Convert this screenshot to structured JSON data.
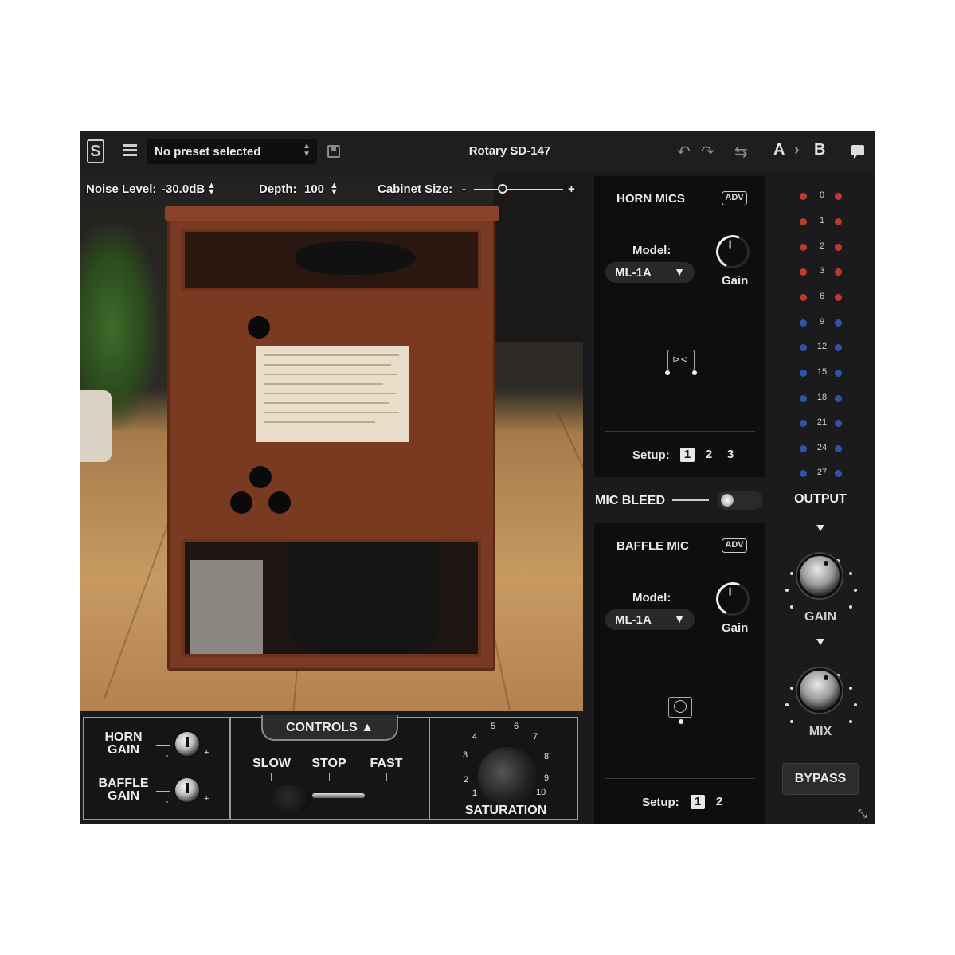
{
  "topbar": {
    "logo": "S",
    "preset": "No preset selected",
    "title": "Rotary SD-147",
    "ab_a": "A",
    "ab_sep": "›",
    "ab_b": "B",
    "icons": [
      "menu-icon",
      "save-icon",
      "undo-icon",
      "redo-icon",
      "compare-icon",
      "chat-icon"
    ]
  },
  "scene_params": {
    "noise_label": "Noise Level:",
    "noise_value": "-30.0dB",
    "depth_label": "Depth:",
    "depth_value": "100",
    "cabinet_label": "Cabinet Size:",
    "cabinet_minus": "-",
    "cabinet_plus": "+",
    "cabinet_size_position": 0.32
  },
  "controls": {
    "tab_label": "CONTROLS ▲",
    "horn_gain": "HORN\nGAIN",
    "baffle_gain": "BAFFLE\nGAIN",
    "minus": "-",
    "plus": "+",
    "slow": "SLOW",
    "stop": "STOP",
    "fast": "FAST",
    "saturation": "SATURATION",
    "saturation_scale": [
      "1",
      "2",
      "3",
      "4",
      "5",
      "6",
      "7",
      "8",
      "9",
      "10"
    ]
  },
  "horn_mics": {
    "title": "HORN MICS",
    "adv": "ADV",
    "model_label": "Model:",
    "model_value": "ML-1A",
    "gain_label": "Gain",
    "setup_label": "Setup:",
    "setups": [
      "1",
      "2",
      "3"
    ],
    "active_setup": "1"
  },
  "mic_bleed": {
    "label": "MIC BLEED"
  },
  "baffle_mic": {
    "title": "BAFFLE MIC",
    "adv": "ADV",
    "model_label": "Model:",
    "model_value": "ML-1A",
    "gain_label": "Gain",
    "setup_label": "Setup:",
    "setups": [
      "1",
      "2"
    ],
    "active_setup": "1"
  },
  "output": {
    "meter_scale": [
      "0",
      "1",
      "2",
      "3",
      "6",
      "9",
      "12",
      "15",
      "18",
      "21",
      "24",
      "27"
    ],
    "label": "OUTPUT",
    "gain_label": "GAIN",
    "mix_label": "MIX",
    "bypass_label": "BYPASS"
  },
  "colors": {
    "led_red": "#c0392b",
    "led_blue": "#2f55a8",
    "panel_bg": "#0e0e0f",
    "plugin_bg": "#1b1b1d"
  }
}
